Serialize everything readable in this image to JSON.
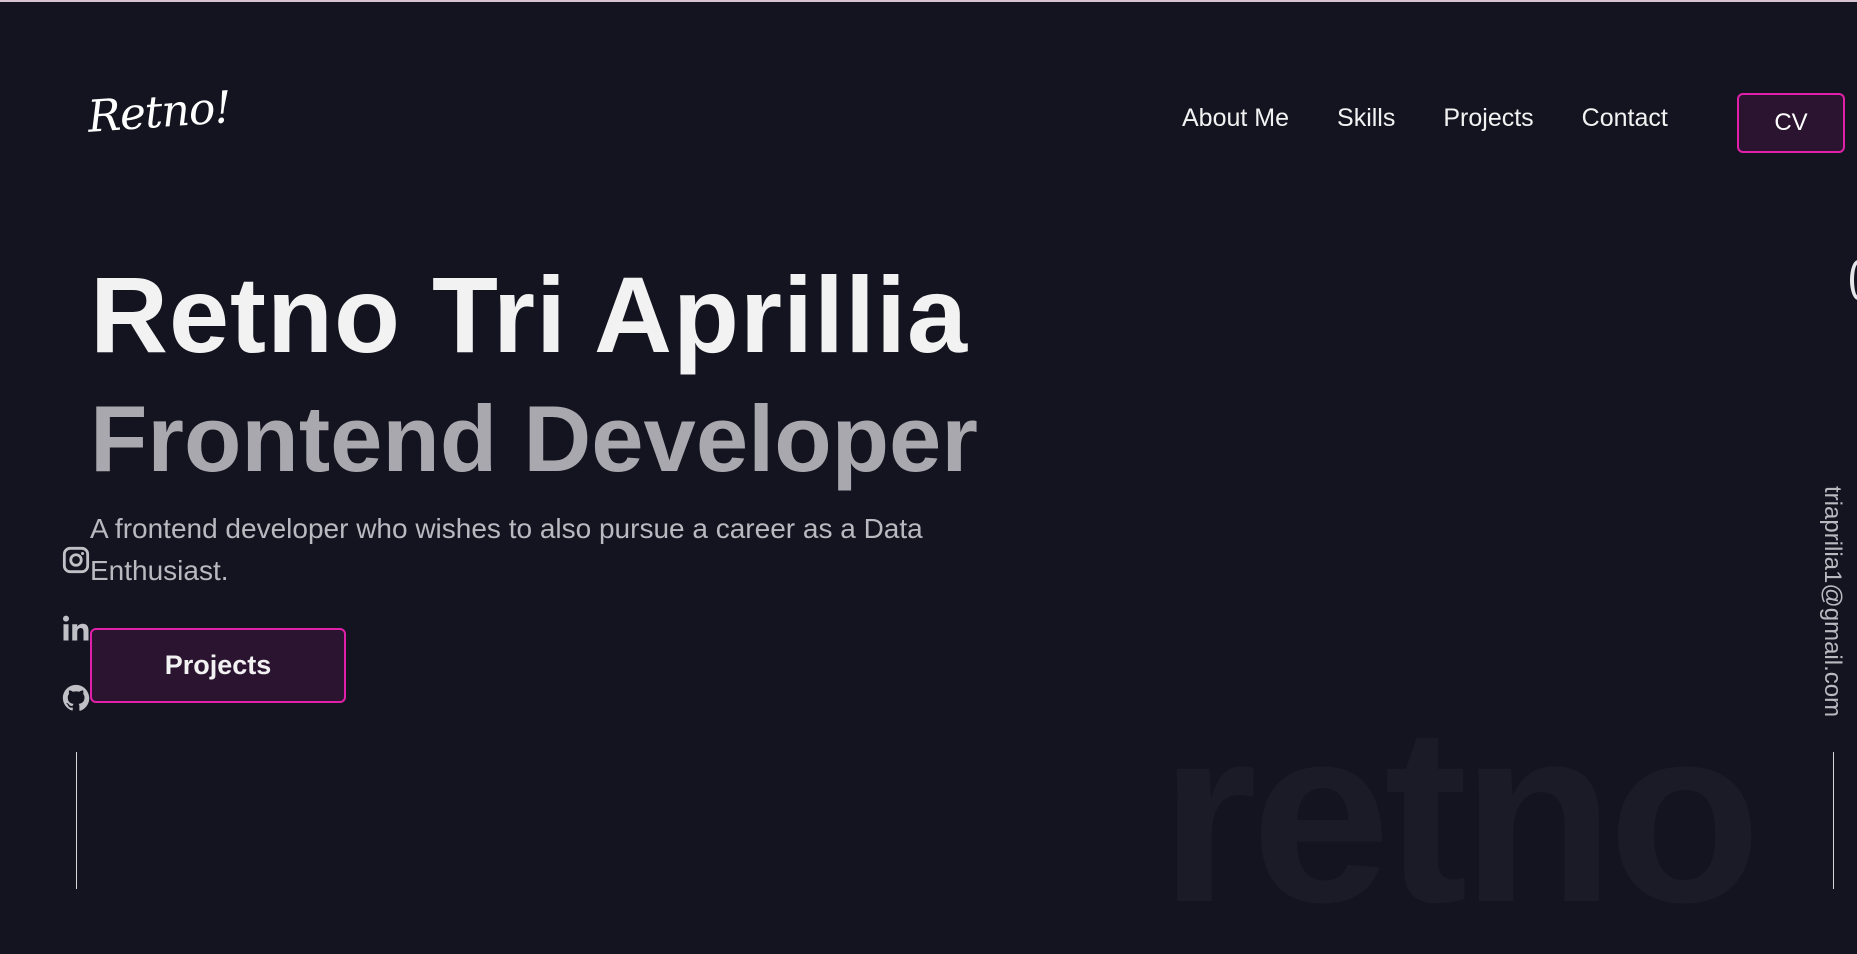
{
  "brand": {
    "logo": "Retno!"
  },
  "nav": {
    "items": [
      "About Me",
      "Skills",
      "Projects",
      "Contact"
    ],
    "cv_label": "CV"
  },
  "hero": {
    "name": "Retno Tri Aprillia",
    "role": "Frontend Developer",
    "description": "A frontend developer who wishes to also pursue a career as a Data Enthusiast.",
    "cta_label": "Projects"
  },
  "social": {
    "icons": [
      "instagram-icon",
      "linkedin-icon",
      "github-icon"
    ]
  },
  "contact": {
    "email": "triaprilia1@gmail.com"
  },
  "background": {
    "watermark": "retno"
  },
  "colors": {
    "background": "#141421",
    "accent": "#e020a8",
    "button_fill": "#2b1430",
    "primary_text": "#f2f2f2",
    "muted_text": "#a9a8ae"
  }
}
